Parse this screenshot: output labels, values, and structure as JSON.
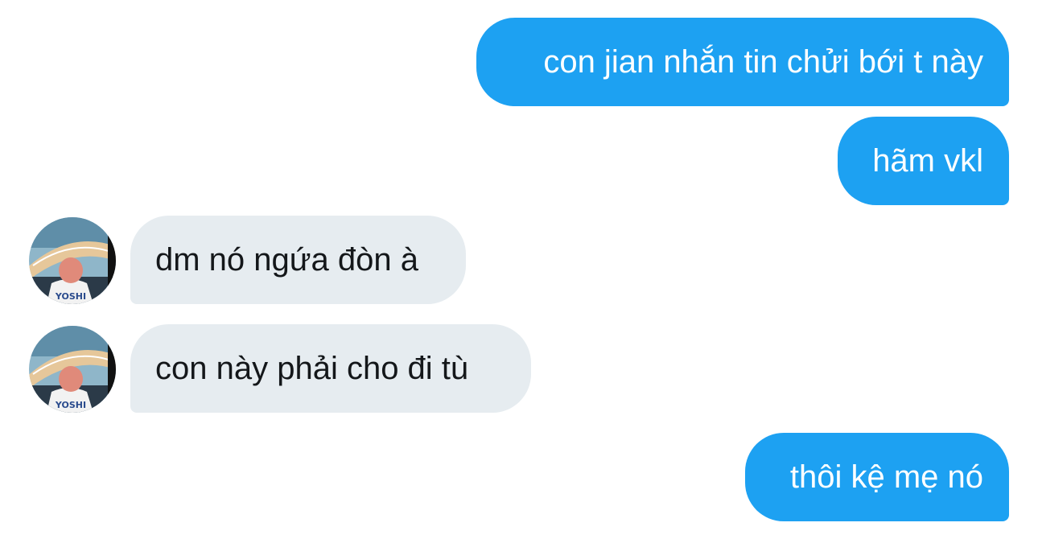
{
  "messages": [
    {
      "direction": "outgoing",
      "text": "con jian nhắn tin chửi bới t này"
    },
    {
      "direction": "outgoing",
      "text": "hãm vkl"
    },
    {
      "direction": "incoming",
      "text": "dm nó ngứa đòn à"
    },
    {
      "direction": "incoming",
      "text": "con này phải cho đi tù"
    },
    {
      "direction": "outgoing",
      "text": "thôi kệ mẹ nó"
    }
  ],
  "avatar": {
    "jersey_text": "YOSHI"
  },
  "colors": {
    "outgoing_bubble": "#1da1f2",
    "outgoing_text": "#ffffff",
    "incoming_bubble": "#e6ecf0",
    "incoming_text": "#14171a",
    "background": "#ffffff"
  }
}
